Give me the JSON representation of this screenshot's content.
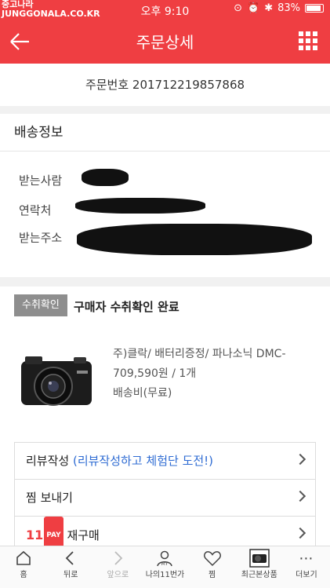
{
  "status": {
    "watermark_line1": "중고나라",
    "watermark_line2": "JUNGGONALA.CO.KR",
    "time": "오후 9:10",
    "battery": "83%",
    "battery_level": 0.83
  },
  "appbar": {
    "title": "주문상세"
  },
  "order": {
    "number_label": "주문번호 201712219857868"
  },
  "shipping": {
    "heading": "배송정보",
    "recipient_label": "받는사람",
    "contact_label": "연락처",
    "address_label": "받는주소"
  },
  "status_block": {
    "badge": "수취확인",
    "text": "구매자 수취확인 완료"
  },
  "product": {
    "name": "주)클락/ 배터리증정/ 파나소닉 DMC-",
    "price_qty": "709,590원 / 1개",
    "shipping_fee": "배송비(무료)"
  },
  "actions": {
    "review_label": "리뷰작성",
    "review_hint": "(리뷰작성하고 체험단 도전!)",
    "gift_label": "찜 보내기",
    "pay_brand": "11",
    "pay_tag": "PAY",
    "reorder_label": "재구매"
  },
  "nav": {
    "home": "홈",
    "back": "뒤로",
    "forward": "앞으로",
    "my": "나의11번가",
    "my_icon_text": "MY",
    "wish": "찜",
    "recent": "최근본상품",
    "more": "더보기"
  },
  "colors": {
    "brand": "#ef3e42",
    "link": "#2f6cd3"
  }
}
